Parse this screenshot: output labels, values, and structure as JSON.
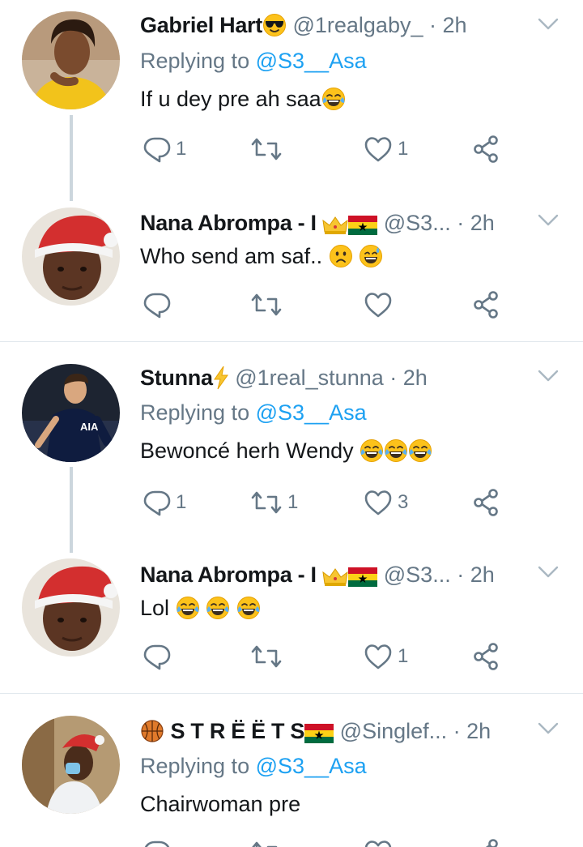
{
  "colors": {
    "name": "#14171a",
    "secondary": "#657786",
    "accent": "#1da1f2",
    "divider": "#e1e8ed"
  },
  "tweets": [
    {
      "name": "Gabriel Hart",
      "name_emoji": "smiling-face-with-sunglasses",
      "handle": "@1realgaby_",
      "time": "· 2h",
      "replying_prefix": "Replying to",
      "replying_to": "@S3__Asa",
      "text": "If u dey pre ah saa",
      "text_emojis": [
        "face-with-tears-of-joy"
      ],
      "reply_count": "1",
      "retweet_count": "",
      "like_count": "1"
    },
    {
      "name": "Nana Abrompa - I",
      "name_emoji": "crown-and-ghana-flag",
      "handle": "@S3...",
      "time": "· 2h",
      "text": "Who send am saf..",
      "text_emojis": [
        "slightly-frowning-face",
        "grinning-face-with-sweat"
      ],
      "reply_count": "",
      "retweet_count": "",
      "like_count": ""
    },
    {
      "name": "Stunna",
      "name_emoji": "high-voltage",
      "handle": "@1real_stunna",
      "time": "· 2h",
      "replying_prefix": "Replying to",
      "replying_to": "@S3__Asa",
      "text": "Bewoncé herh Wendy",
      "text_emojis": [
        "face-with-tears-of-joy",
        "face-with-tears-of-joy",
        "face-with-tears-of-joy"
      ],
      "avatar_badge": "AIA",
      "reply_count": "1",
      "retweet_count": "1",
      "like_count": "3"
    },
    {
      "name": "Nana Abrompa - I",
      "name_emoji": "crown-and-ghana-flag",
      "handle": "@S3...",
      "time": "· 2h",
      "text": "Lol",
      "text_emojis": [
        "face-with-tears-of-joy",
        "face-with-tears-of-joy",
        "face-with-tears-of-joy"
      ],
      "reply_count": "",
      "retweet_count": "",
      "like_count": "1"
    },
    {
      "name_prefix_emoji": "basketball",
      "name": "S T R Ë Ë T S",
      "name_emoji": "ghana-flag",
      "handle": "@Singlef...",
      "time": "· 2h",
      "replying_prefix": "Replying to",
      "replying_to": "@S3__Asa",
      "text": "Chairwoman pre"
    }
  ]
}
